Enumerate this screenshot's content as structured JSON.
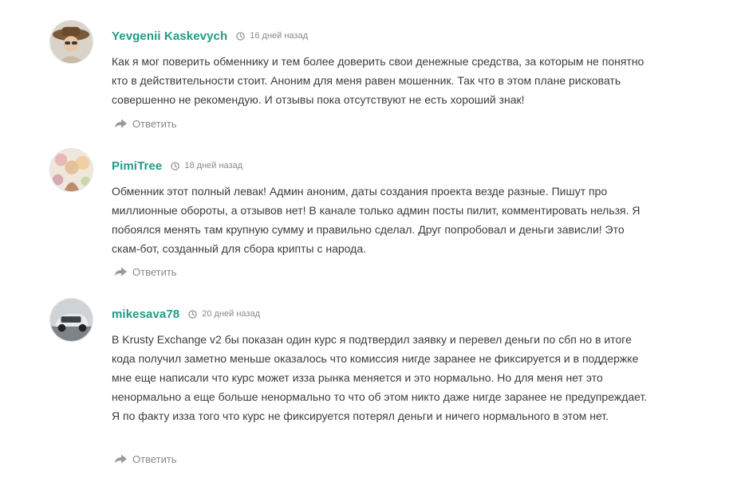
{
  "comments": [
    {
      "author": "Yevgenii Kaskevych",
      "time_ago": "16 дней назад",
      "text": "Как я мог поверить обменнику и тем более доверить свои денежные средства, за которым не понятно кто в действительности стоит. Аноним для меня равен мошенник. Так что в этом плане рисковать совершенно не рекомендую. И отзывы пока отсутствуют не есть хороший знак!",
      "reply_label": "Ответить",
      "avatar_icon": "user-photo-hat"
    },
    {
      "author": "PimiTree",
      "time_ago": "18 дней назад",
      "text": "Обменник этот полный левак! Админ аноним, даты создания проекта везде разные. Пишут про миллионные обороты, а отзывов нет! В канале только админ посты пилит, комментировать нельзя. Я побоялся менять там крупную сумму и правильно сделал. Друг попробовал и деньги зависли! Это скам-бот, созданный для сбора крипты с народа.",
      "reply_label": "Ответить",
      "avatar_icon": "user-photo-flowers"
    },
    {
      "author": "mikesava78",
      "time_ago": "20 дней назад",
      "text": "В Krusty Exchange v2 бы показан один курс я подтвердил заявку и перевел деньги по сбп но в итоге кода получил заметно меньше оказалось что комиссия нигде заранее не фиксируется и в поддержке мне еще написали что курс может изза рынка меняется и это нормально. Но для меня нет это ненормально а еще больше ненормально то что об этом никто даже нигде заранее не предупреждает. Я по факту изза того что курс не фиксируется потерял деньги и ничего нормального в этом нет.",
      "reply_label": "Ответить",
      "avatar_icon": "user-photo-car"
    }
  ],
  "colors": {
    "author": "#1f9c86",
    "text": "#3c3c3c",
    "muted": "#8a8a8a"
  }
}
